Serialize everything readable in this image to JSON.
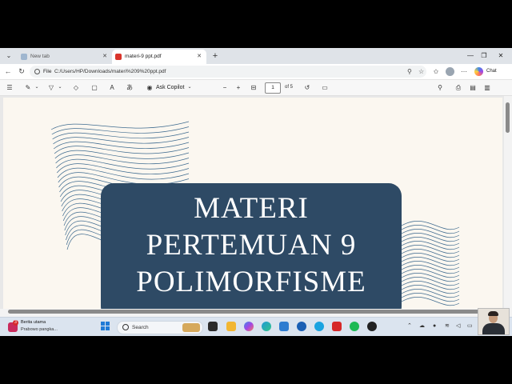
{
  "browser": {
    "tabs": [
      {
        "label": "New tab",
        "active": false
      },
      {
        "label": "materi-9 ppt.pdf",
        "active": true
      }
    ],
    "address": {
      "scheme_label": "File",
      "path": "C:/Users/HP/Downloads/materi%209%20ppt.pdf"
    },
    "chat_label": "Chat"
  },
  "pdf_toolbar": {
    "ask_copilot": "Ask Copilot",
    "page_current": "1",
    "page_total": "of 5"
  },
  "document": {
    "title_lines": [
      "MATERI",
      "PERTEMUAN 9",
      "POLIMORFISME"
    ],
    "title_bg": "#2e4a65",
    "page_bg": "#fbf7f0",
    "wave_color": "#3f6b8f"
  },
  "taskbar": {
    "news_badge": "3",
    "news_title": "Berita utama",
    "news_sub": "Prabowo pangka...",
    "search_label": "Search"
  },
  "icons": [
    "tab-menu-icon",
    "pdf-icon",
    "close-icon",
    "plus-icon",
    "minimize-icon",
    "maximize-icon",
    "back-icon",
    "refresh-icon",
    "info-icon",
    "zoom-icon",
    "star-icon",
    "favorites-icon",
    "more-icon",
    "contents-icon",
    "draw-icon",
    "highlight-icon",
    "eraser-icon",
    "text-icon",
    "read-aloud-icon",
    "translate-icon",
    "copilot-icon",
    "zoom-out-icon",
    "zoom-in-icon",
    "fit-icon",
    "rotate-icon",
    "page-view-icon",
    "search-icon",
    "print-icon",
    "save-icon",
    "save-as-icon",
    "windows-start-icon"
  ]
}
